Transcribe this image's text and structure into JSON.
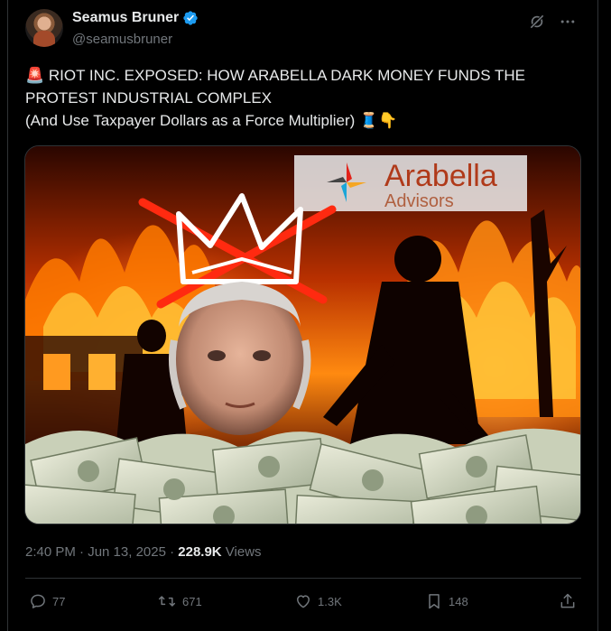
{
  "author": {
    "name": "Seamus Bruner",
    "handle": "@seamusbruner",
    "verified": true
  },
  "tweet": {
    "line1": "🚨 RIOT INC. EXPOSED: HOW ARABELLA DARK MONEY FUNDS THE",
    "line2": "PROTEST INDUSTRIAL COMPLEX",
    "line3": "(And Use Taxpayer Dollars as a Force Multiplier) 🧵👇"
  },
  "media": {
    "logo_line1": "Arabella",
    "logo_line2": "Advisors"
  },
  "meta": {
    "time": "2:40 PM · Jun 13, 2025 · ",
    "views_count": "228.9K",
    "views_label": " Views"
  },
  "actions": {
    "replies": "77",
    "reposts": "671",
    "likes": "1.3K",
    "bookmarks": "148"
  },
  "colors": {
    "accent": "#1d9bf0",
    "muted": "#71767b",
    "text": "#e7e9ea",
    "fire": "#ff7a00"
  },
  "icons": [
    "verified-badge-icon",
    "grok-icon",
    "more-icon",
    "reply-icon",
    "repost-icon",
    "like-icon",
    "bookmark-icon",
    "share-icon"
  ]
}
